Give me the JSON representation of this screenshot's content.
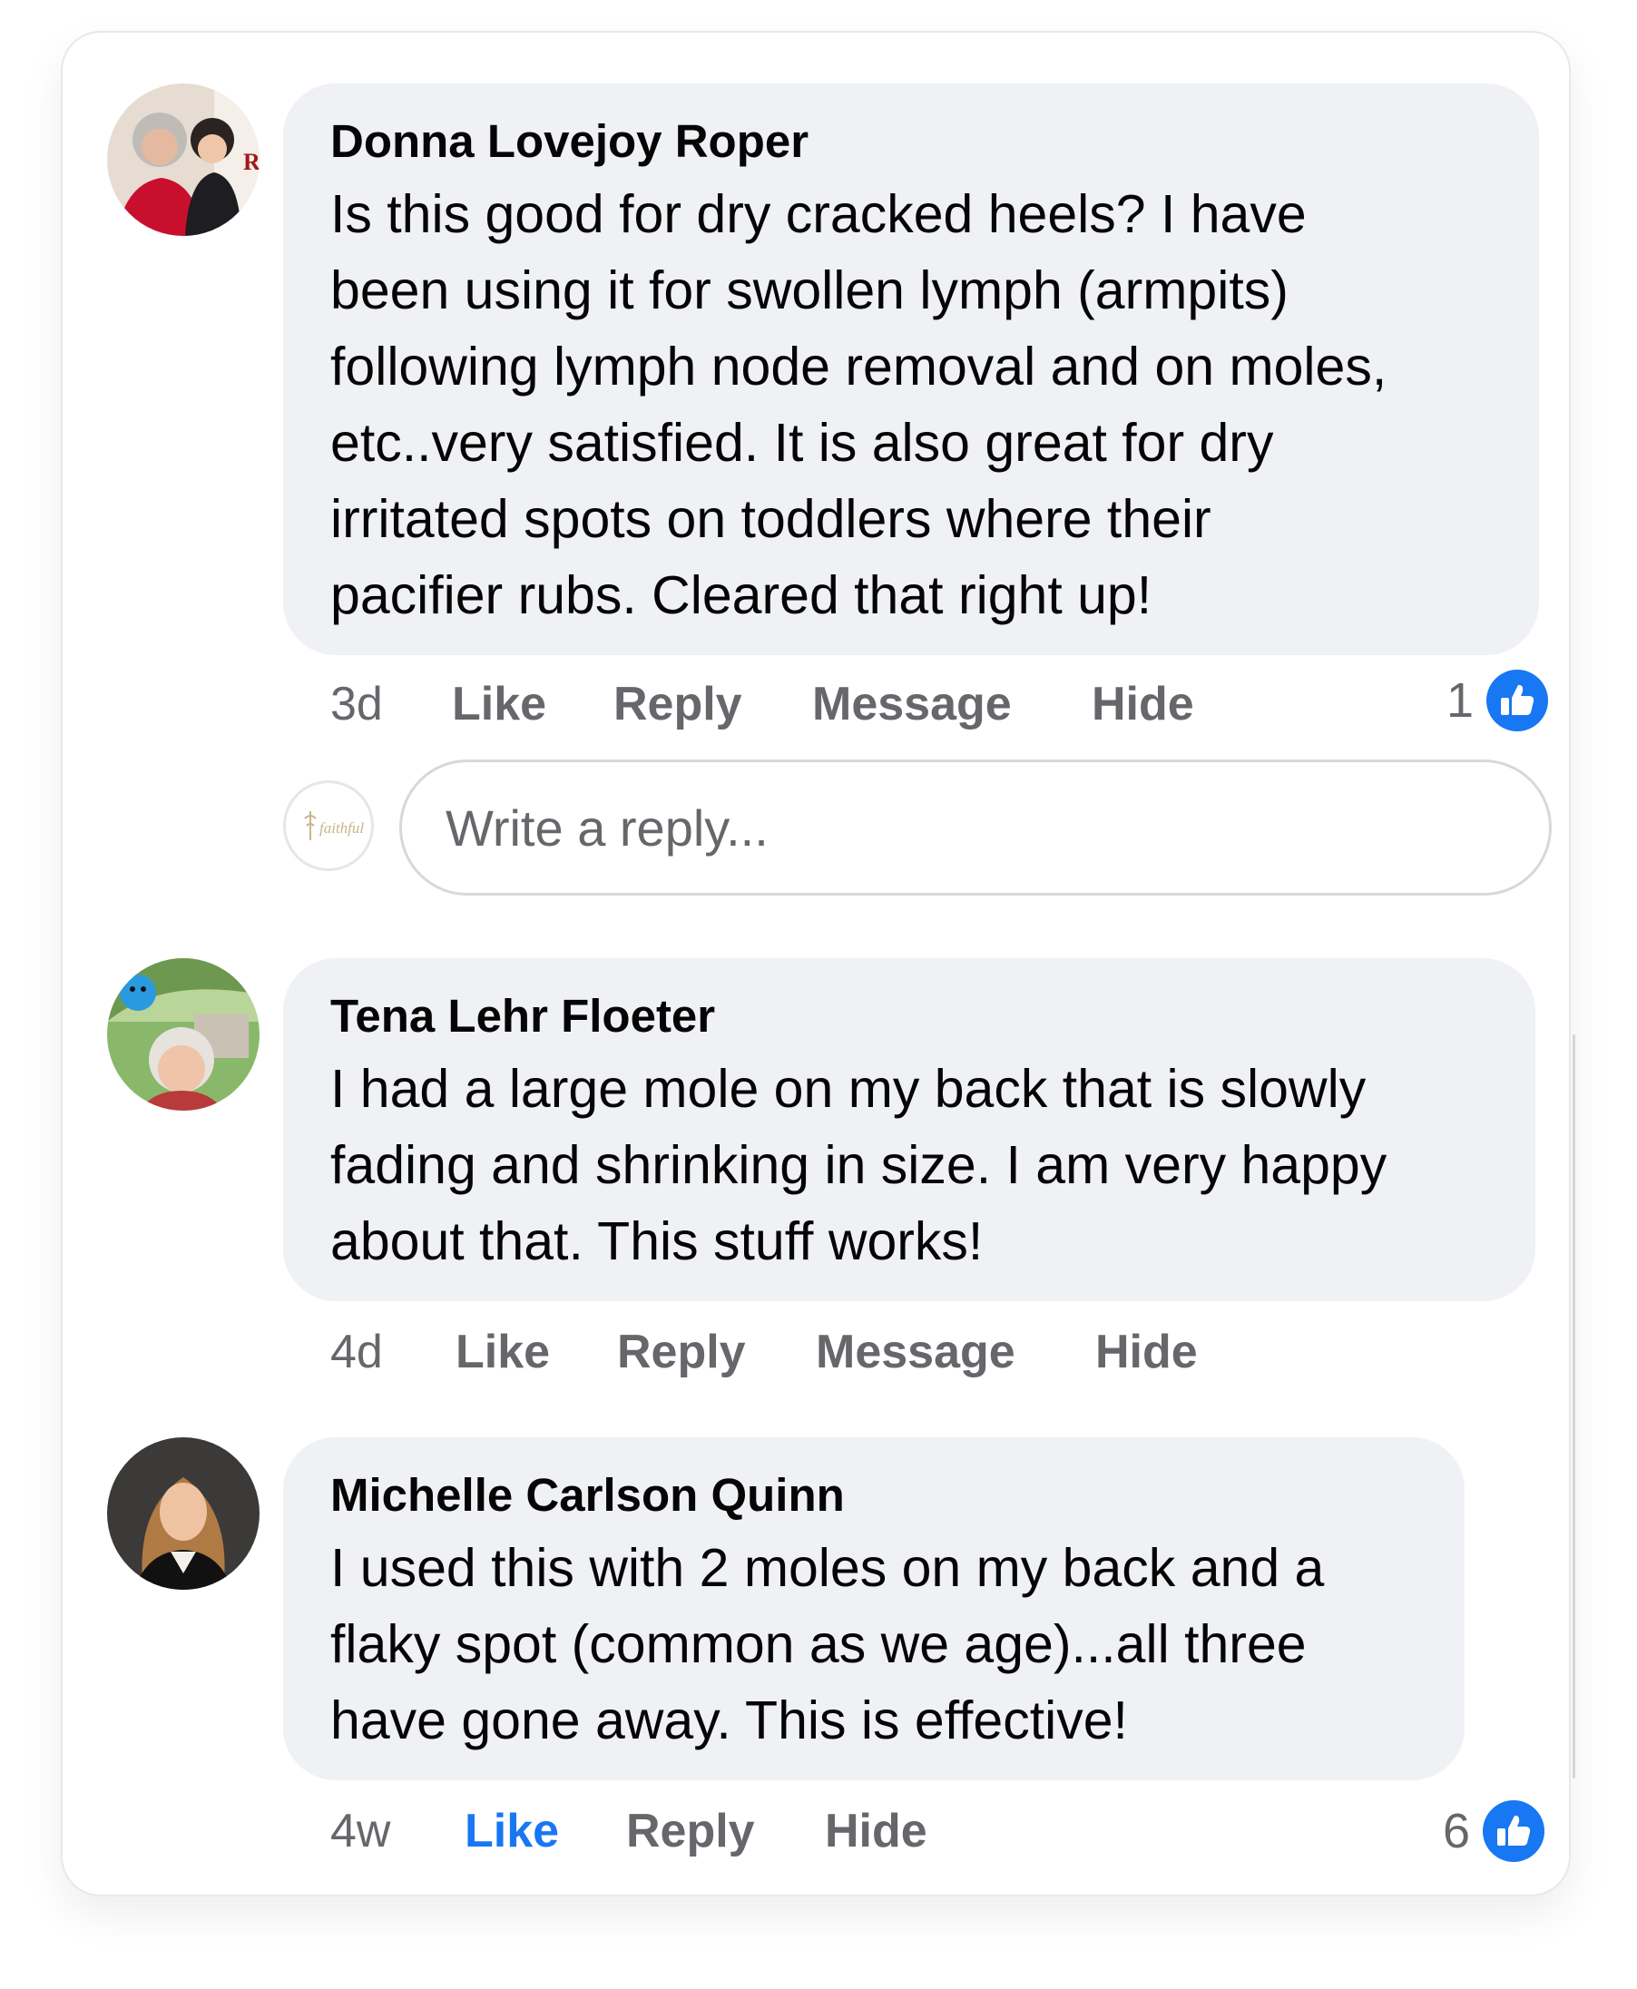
{
  "comments": [
    {
      "author": "Donna Lovejoy Roper",
      "lines": [
        "Is this good for dry cracked heels? I have",
        "been using it for swollen lymph (armpits)",
        "following lymph node removal and on moles,",
        "etc..very satisfied. It is also great for dry",
        "irritated spots on toddlers where their",
        "pacifier rubs. Cleared that right up!"
      ],
      "time": "3d",
      "actions": [
        "Like",
        "Reply",
        "Message",
        "Hide"
      ],
      "reaction_count": "1"
    },
    {
      "author": "Tena Lehr Floeter",
      "lines": [
        "I had a large mole on my back that is slowly",
        "fading and shrinking in size. I am very happy",
        "about that. This stuff works!"
      ],
      "time": "4d",
      "actions": [
        "Like",
        "Reply",
        "Message",
        "Hide"
      ]
    },
    {
      "author": "Michelle Carlson Quinn",
      "lines": [
        "I used this with 2 moles on my back and a",
        "flaky spot (common as we age)...all three",
        "have gone away. This is effective!"
      ],
      "time": "4w",
      "actions": [
        "Like",
        "Reply",
        "Hide"
      ],
      "reaction_count": "6",
      "liked_by_viewer": true
    }
  ],
  "reply_box": {
    "placeholder": "Write a reply...",
    "avatar_logo_text": "faithful"
  },
  "colors": {
    "bubble": "#f0f1f4",
    "text": "#050505",
    "secondary": "#65676b",
    "accent": "#1877f2"
  },
  "icons": {
    "reaction": "thumbs-up-icon"
  }
}
